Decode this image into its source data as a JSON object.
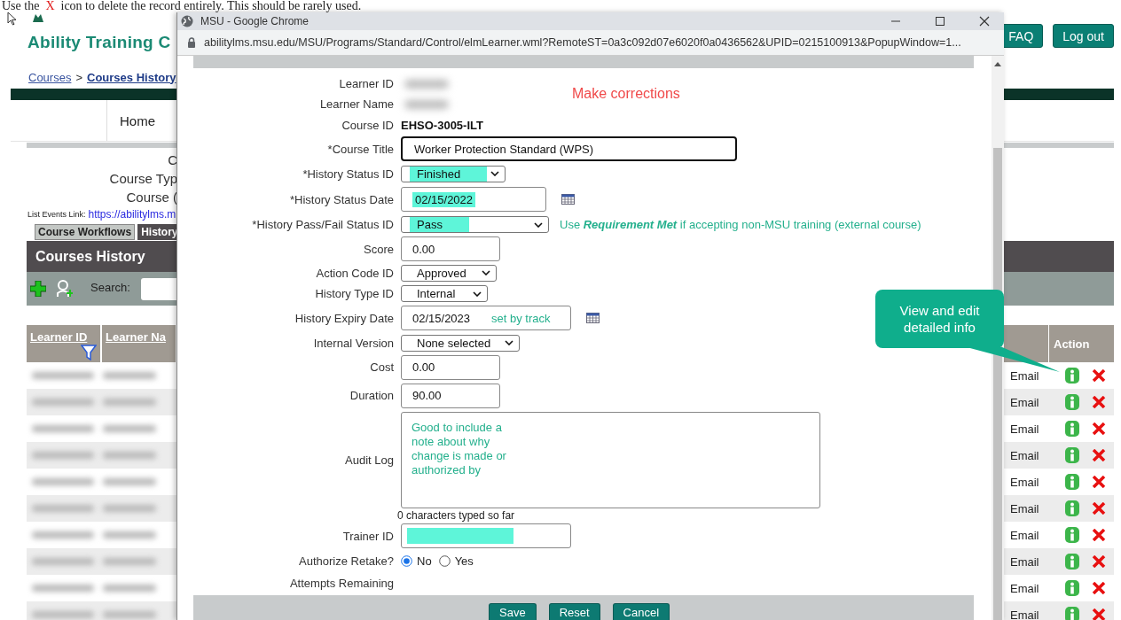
{
  "note": {
    "before": "Use the",
    "mark": "X",
    "after": "icon to delete the record entirely. This should be rarely used."
  },
  "site": {
    "title": "Ability Training C",
    "header_buttons": [
      "FAQ",
      "Log out"
    ],
    "breadcrumb": [
      {
        "label": "Courses",
        "current": false
      },
      {
        "label": "Courses History",
        "current": true
      }
    ],
    "breadcrumb_separator": ">",
    "nav": [
      "Home"
    ]
  },
  "course_info": {
    "lines": [
      "C",
      "Course Typ",
      "Course ("
    ],
    "events_label": "List Events Link:",
    "events_link": "https://abilitylms.m"
  },
  "tabs": [
    {
      "label": "Course Workflows",
      "selected": false
    },
    {
      "label": "History",
      "selected": true
    }
  ],
  "panel": {
    "title": "Courses History",
    "search_label": "Search:"
  },
  "table": {
    "columns": [
      {
        "label": "Learner ID",
        "filter": true
      },
      {
        "label": "Learner Na",
        "filter": false
      }
    ],
    "action_column": "Action",
    "rows": [
      {
        "email": "Email"
      },
      {
        "email": "Email"
      },
      {
        "email": "Email"
      },
      {
        "email": "Email"
      },
      {
        "email": "Email"
      },
      {
        "email": "Email"
      },
      {
        "email": "Email"
      },
      {
        "email": "Email"
      },
      {
        "email": "Email"
      },
      {
        "email": "Email"
      }
    ]
  },
  "popup": {
    "title": "MSU - Google Chrome",
    "url": "abilitylms.msu.edu/MSU/Programs/Standard/Control/elmLearner.wml?RemoteST=0a3c092d07e6020f0a0436562&UPID=0215100913&PopupWindow=1...",
    "note": "Make corrections",
    "fields": [
      {
        "kind": "static",
        "label": "Learner ID",
        "blurred": true
      },
      {
        "kind": "static",
        "label": "Learner Name",
        "blurred": true
      },
      {
        "kind": "static",
        "label": "Course ID",
        "value": "EHSO-3005-ILT"
      },
      {
        "kind": "input",
        "label": "*Course Title",
        "value": "Worker Protection Standard (WPS)",
        "focused": true
      },
      {
        "kind": "select",
        "label": "*History Status ID",
        "value": "Finished",
        "highlighted": true
      },
      {
        "kind": "date",
        "label": "*History Status Date",
        "value": "02/15/2022",
        "highlighted": true
      },
      {
        "kind": "select",
        "label": "*History Pass/Fail Status ID",
        "value": "Pass",
        "highlighted": true,
        "hint": "Use **Requirement Met** if accepting non-MSU training (external course)"
      },
      {
        "kind": "input",
        "label": "Score",
        "value": "0.00"
      },
      {
        "kind": "select",
        "label": "Action Code ID",
        "value": "Approved"
      },
      {
        "kind": "select",
        "label": "History Type ID",
        "value": "Internal"
      },
      {
        "kind": "date",
        "label": "History Expiry Date",
        "value": "02/15/2023",
        "note": "set by track"
      },
      {
        "kind": "select",
        "label": "Internal Version",
        "value": "None selected"
      },
      {
        "kind": "input",
        "label": "Cost",
        "value": "0.00"
      },
      {
        "kind": "input",
        "label": "Duration",
        "value": "90.00"
      },
      {
        "kind": "textarea",
        "label": "Audit Log",
        "annotation": "Good to include a note about why change is made or authorized by",
        "counter": "0 characters typed so far"
      },
      {
        "kind": "input",
        "label": "Trainer ID",
        "highlighted": true
      },
      {
        "kind": "radio",
        "label": "Authorize Retake?",
        "options": [
          {
            "label": "No",
            "selected": true
          },
          {
            "label": "Yes",
            "selected": false
          }
        ]
      },
      {
        "kind": "static",
        "label": "Attempts Remaining"
      }
    ],
    "buttons": [
      "Save",
      "Reset",
      "Cancel"
    ]
  },
  "callout": {
    "text": "View and edit detailed info"
  }
}
